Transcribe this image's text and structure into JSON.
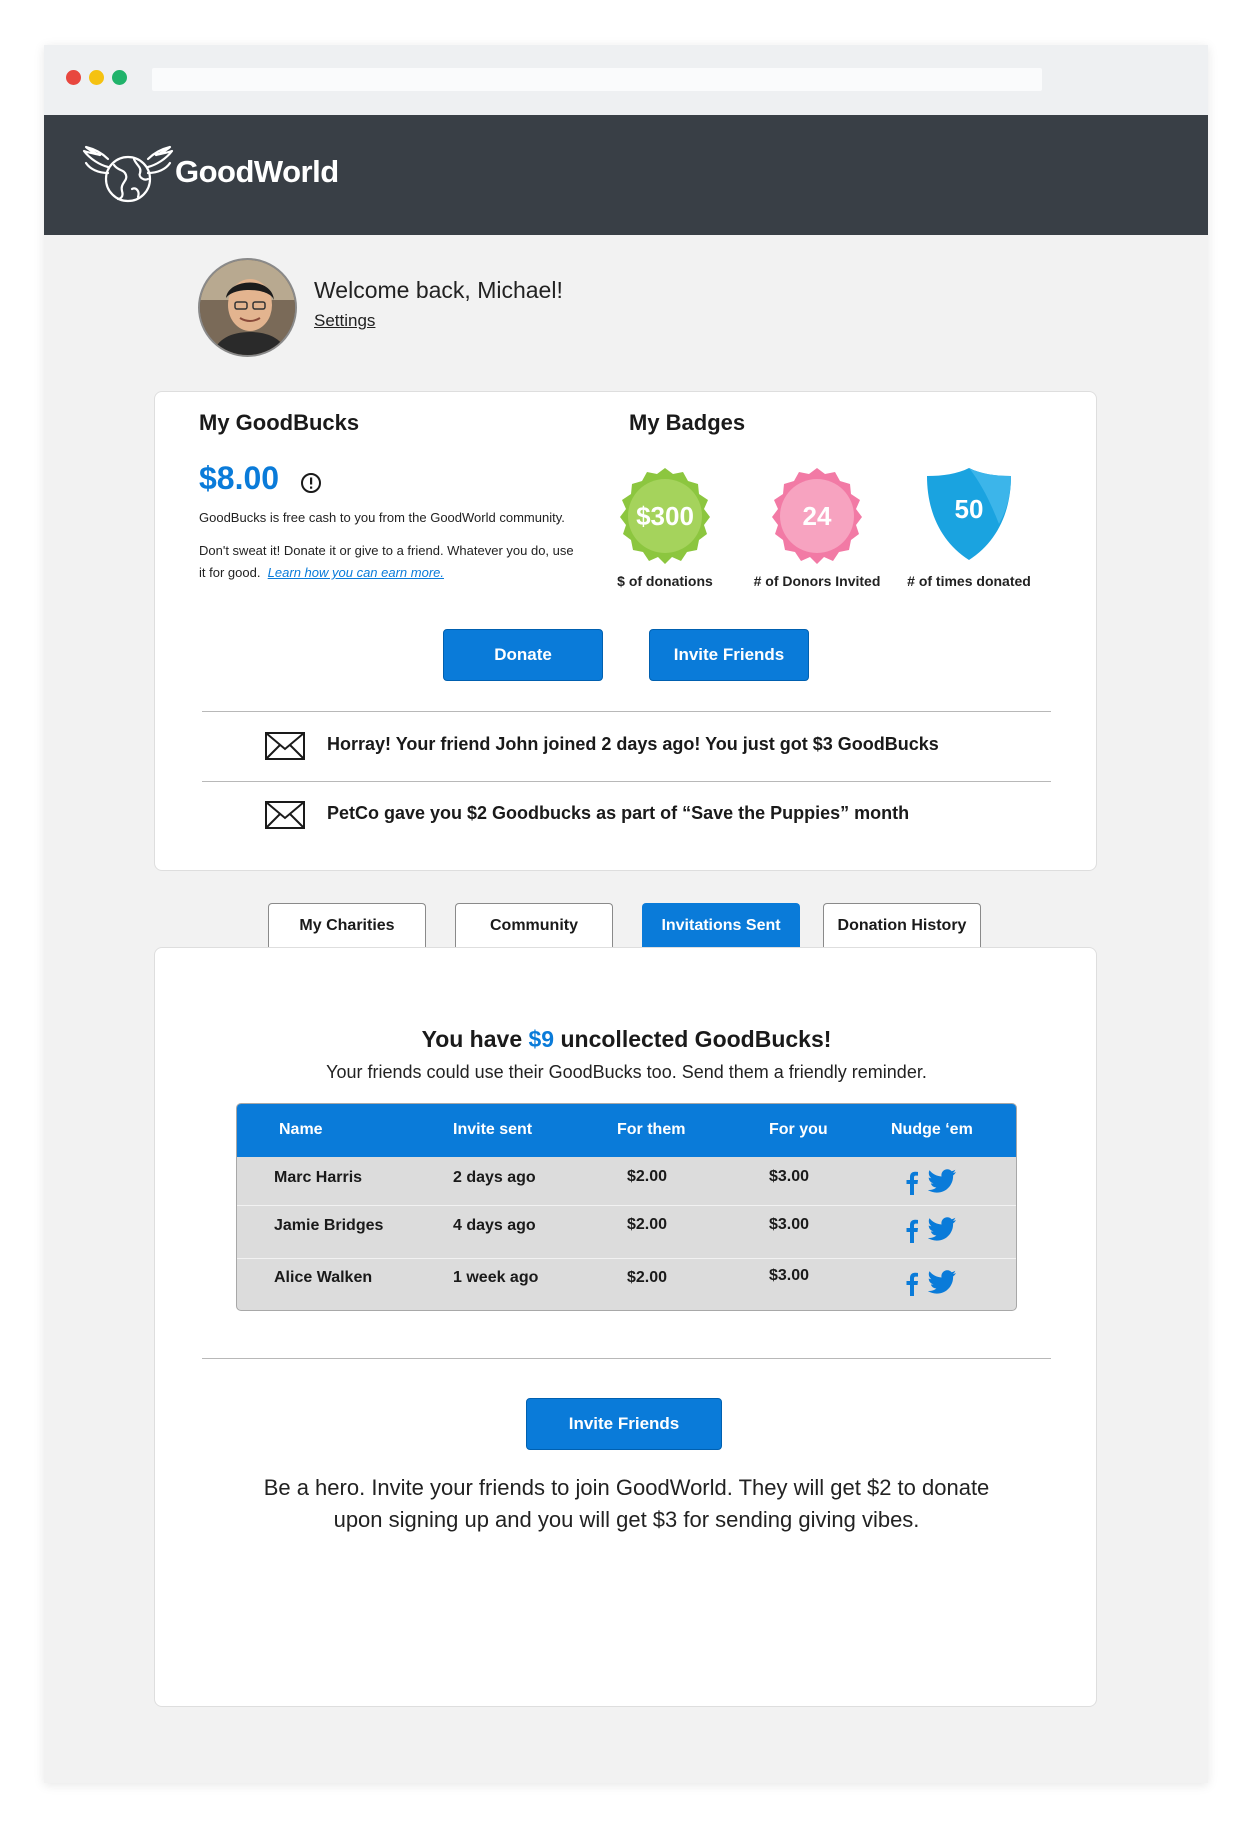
{
  "brand": {
    "name": "GoodWorld",
    "accent": "#0a7bd9",
    "header_bg": "#393f46"
  },
  "window": {
    "dots": [
      "#e8473f",
      "#f5c211",
      "#20b36b"
    ]
  },
  "user": {
    "welcome": "Welcome back, Michael!",
    "settings_label": "Settings"
  },
  "goodbucks": {
    "title": "My GoodBucks",
    "amount": "$8.00",
    "desc1": "GoodBucks is free cash to you from the GoodWorld community.",
    "desc2": "Don't sweat it! Donate it or give to a friend. Whatever you do, use it for good.",
    "learn_link": "Learn how you can earn more."
  },
  "badges": {
    "title": "My Badges",
    "items": [
      {
        "value": "$300",
        "label": "$ of donations",
        "color": "#8cc63f"
      },
      {
        "value": "24",
        "label": "# of Donors Invited",
        "color": "#f27aa5"
      },
      {
        "value": "50",
        "label": "# of times donated",
        "color": "#1aa3e0"
      }
    ]
  },
  "actions": {
    "donate": "Donate",
    "invite": "Invite Friends"
  },
  "notifications": [
    "Horray! Your friend John joined 2 days ago! You just got $3 GoodBucks",
    "PetCo gave you $2 Goodbucks as part of “Save the Puppies” month"
  ],
  "tabs": [
    "My Charities",
    "Community",
    "Invitations Sent",
    "Donation History"
  ],
  "active_tab": "Invitations Sent",
  "invitations": {
    "heading_pre": "You have ",
    "heading_amount": "$9",
    "heading_post": " uncollected GoodBucks!",
    "subtitle": "Your friends could use their GoodBucks too. Send them a friendly reminder.",
    "columns": [
      "Name",
      "Invite sent",
      "For them",
      "For you",
      "Nudge ‘em"
    ],
    "rows": [
      {
        "name": "Marc Harris",
        "sent": "2 days ago",
        "them": "$2.00",
        "you": "$3.00"
      },
      {
        "name": "Jamie Bridges",
        "sent": "4 days ago",
        "them": "$2.00",
        "you": "$3.00"
      },
      {
        "name": "Alice Walken",
        "sent": "1 week ago",
        "them": "$2.00",
        "you": "$3.00"
      }
    ],
    "invite_button": "Invite Friends",
    "bottom_text": "Be a hero. Invite your friends to join GoodWorld. They will get $2 to donate upon signing up and you will get $3 for sending giving vibes."
  }
}
